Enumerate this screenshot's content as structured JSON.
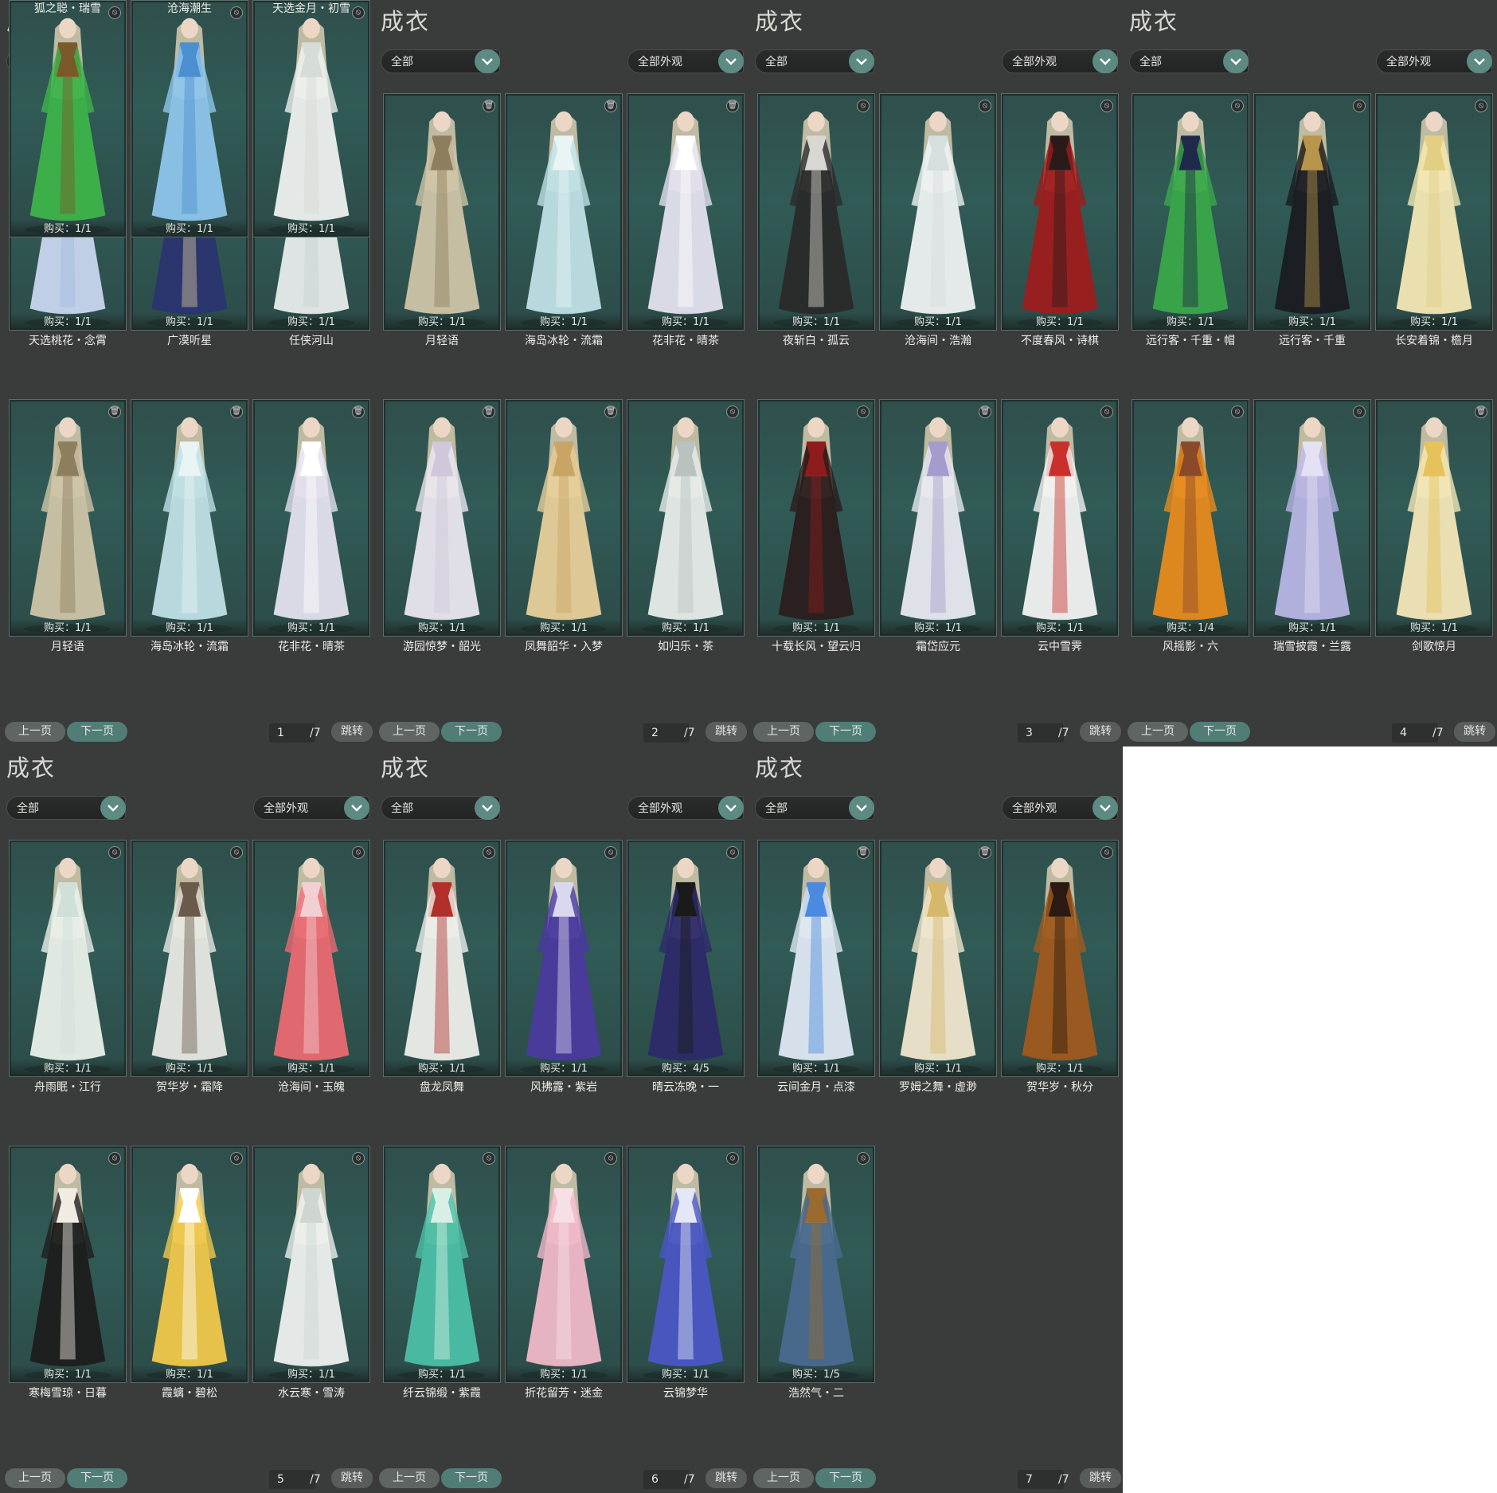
{
  "common": {
    "title": "成衣",
    "filter_left": "全部",
    "filter_right": "全部外观",
    "prev": "上一页",
    "next": "下一页",
    "jump": "跳转",
    "total": "/7"
  },
  "panels": [
    {
      "page": "1",
      "items": [
        {
          "name": "天选桃花・念霄",
          "buy": "购买：1/1",
          "icon": "trash-icon",
          "outfit": "#c9d6ee",
          "accent": "#9fb7e0"
        },
        {
          "name": "广漠听星",
          "buy": "购买：1/1",
          "icon": "trash-icon",
          "outfit": "#2b3470",
          "accent": "#d8c89a"
        },
        {
          "name": "任侠河山",
          "buy": "购买：1/1",
          "icon": "trash-icon",
          "outfit": "#e8ecec",
          "accent": "#c8d0d0"
        },
        {
          "name": "月轻语",
          "buy": "购买：1/1",
          "icon": "trash-icon",
          "outfit": "#cfc4a8",
          "accent": "#8d7f5d"
        },
        {
          "name": "海岛冰轮・流霜",
          "buy": "购买：1/1",
          "icon": "trash-icon",
          "outfit": "#bfe0e6",
          "accent": "#e9f4f4"
        },
        {
          "name": "花非花・晴茶",
          "buy": "购买：1/1",
          "icon": "trash-icon",
          "outfit": "#e4e0ee",
          "accent": "#ffffff"
        },
        {
          "name": "狐之聪・瑞雪",
          "buy": "购买：1/1",
          "icon": "slash-icon",
          "outfit": "#3db44a",
          "accent": "#7a5a2a"
        },
        {
          "name": "沧海潮生",
          "buy": "购买：1/1",
          "icon": "slash-icon",
          "outfit": "#8ec5ea",
          "accent": "#4b8fd0"
        },
        {
          "name": "天选金月・初雪",
          "buy": "购买：1/1",
          "icon": "slash-icon",
          "outfit": "#eef0ee",
          "accent": "#d6dcd8"
        }
      ]
    },
    {
      "page": "2",
      "items": [
        {
          "name": "月轻语",
          "buy": "购买：1/1",
          "icon": "trash-icon",
          "outfit": "#cfc4a8",
          "accent": "#8d7f5d"
        },
        {
          "name": "海岛冰轮・流霜",
          "buy": "购买：1/1",
          "icon": "trash-icon",
          "outfit": "#bfe0e6",
          "accent": "#e9f4f4"
        },
        {
          "name": "花非花・晴茶",
          "buy": "购买：1/1",
          "icon": "trash-icon",
          "outfit": "#e4e0ee",
          "accent": "#ffffff"
        },
        {
          "name": "游园惊梦・韶光",
          "buy": "购买：1/1",
          "icon": "trash-icon",
          "outfit": "#eae6ee",
          "accent": "#cfc8da"
        },
        {
          "name": "凤舞韶华・入梦",
          "buy": "购买：1/1",
          "icon": "trash-icon",
          "outfit": "#e8cf9a",
          "accent": "#c9a565"
        },
        {
          "name": "如归乐・茶",
          "buy": "购买：1/1",
          "icon": "slash-icon",
          "outfit": "#e8ecea",
          "accent": "#b9c2bf"
        }
      ]
    },
    {
      "page": "3",
      "items": [
        {
          "name": "夜斩白・孤云",
          "buy": "购买：1/1",
          "icon": "slash-icon",
          "outfit": "#2a2a2a",
          "accent": "#d8d8d2"
        },
        {
          "name": "沧海间・浩瀚",
          "buy": "购买：1/1",
          "icon": "slash-icon",
          "outfit": "#eef2f2",
          "accent": "#d6dede"
        },
        {
          "name": "不度春风・诗棋",
          "buy": "购买：1/1",
          "icon": "slash-icon",
          "outfit": "#9e1c1c",
          "accent": "#2a1a1a"
        },
        {
          "name": "十载长风・望云归",
          "buy": "购买：1/1",
          "icon": "slash-icon",
          "outfit": "#2b1d1d",
          "accent": "#8e1c1c"
        },
        {
          "name": "霜岱应元",
          "buy": "购买：1/1",
          "icon": "trash-icon",
          "outfit": "#e8eaf0",
          "accent": "#a59ccd"
        },
        {
          "name": "云中雪霁",
          "buy": "购买：1/1",
          "icon": "slash-icon",
          "outfit": "#f2f2f2",
          "accent": "#c9302c"
        }
      ]
    },
    {
      "page": "4",
      "items": [
        {
          "name": "远行客・千重・帽",
          "buy": "购买：1/1",
          "icon": "slash-icon",
          "outfit": "#3aa84a",
          "accent": "#1f2a4a"
        },
        {
          "name": "远行客・千重",
          "buy": "购买：1/1",
          "icon": "slash-icon",
          "outfit": "#1a1c22",
          "accent": "#b7954a"
        },
        {
          "name": "长安着锦・檐月",
          "buy": "购买：1/1",
          "icon": "slash-icon",
          "outfit": "#f3e7b4",
          "accent": "#e2cf84"
        },
        {
          "name": "风摇影・六",
          "buy": "购买：1/4",
          "icon": "slash-icon",
          "outfit": "#e78a1c",
          "accent": "#8a4a2a"
        },
        {
          "name": "瑞雪披霞・兰露",
          "buy": "购买：1/1",
          "icon": "slash-icon",
          "outfit": "#b8b4e4",
          "accent": "#e4e2f2"
        },
        {
          "name": "剑歌惊月",
          "buy": "购买：1/1",
          "icon": "trash-icon",
          "outfit": "#f3e7b8",
          "accent": "#e6c25a"
        }
      ]
    },
    {
      "page": "5",
      "items": [
        {
          "name": "舟雨眠・江行",
          "buy": "购买：1/1",
          "icon": "slash-icon",
          "outfit": "#eaf0ea",
          "accent": "#cfe0d8"
        },
        {
          "name": "贺华岁・霜降",
          "buy": "购买：1/1",
          "icon": "slash-icon",
          "outfit": "#e8e8e4",
          "accent": "#6a5a4a"
        },
        {
          "name": "沧海间・玉魄",
          "buy": "购买：1/1",
          "icon": "slash-icon",
          "outfit": "#ea6a72",
          "accent": "#f2cfd2"
        },
        {
          "name": "寒梅雪琼・日暮",
          "buy": "购买：1/1",
          "icon": "slash-icon",
          "outfit": "#1e1e1e",
          "accent": "#f0ece4"
        },
        {
          "name": "霞螭・碧松",
          "buy": "购买：1/1",
          "icon": "slash-icon",
          "outfit": "#f0c84a",
          "accent": "#ffffff"
        },
        {
          "name": "水云寒・雪涛",
          "buy": "购买：1/1",
          "icon": "slash-icon",
          "outfit": "#eef0ee",
          "accent": "#cfd6d2"
        }
      ]
    },
    {
      "page": "6",
      "items": [
        {
          "name": "盘龙凤舞",
          "buy": "购买：1/1",
          "icon": "slash-icon",
          "outfit": "#eeeeea",
          "accent": "#b2302c"
        },
        {
          "name": "风拂露・紫岩",
          "buy": "购买：1/1",
          "icon": "slash-icon",
          "outfit": "#4a3a9e",
          "accent": "#d9d8ee"
        },
        {
          "name": "晴云冻晚・一",
          "buy": "购买：4/5",
          "icon": "slash-icon",
          "outfit": "#2d2a6a",
          "accent": "#1a1a1a"
        },
        {
          "name": "纤云锦缎・紫霞",
          "buy": "购买：1/1",
          "icon": "slash-icon",
          "outfit": "#4cbfa5",
          "accent": "#d8efe6"
        },
        {
          "name": "折花留芳・迷金",
          "buy": "购买：1/1",
          "icon": "slash-icon",
          "outfit": "#f0b8c8",
          "accent": "#f7dfe6"
        },
        {
          "name": "云锦梦华",
          "buy": "购买：1/1",
          "icon": "slash-icon",
          "outfit": "#4a56c4",
          "accent": "#e4e8f6"
        }
      ]
    },
    {
      "page": "7",
      "items": [
        {
          "name": "云间金月・点漆",
          "buy": "购买：1/1",
          "icon": "trash-icon",
          "outfit": "#dfe8f2",
          "accent": "#4a8ae0"
        },
        {
          "name": "罗姆之舞・虚渺",
          "buy": "购买：1/1",
          "icon": "trash-icon",
          "outfit": "#f0e6cc",
          "accent": "#d6b86a"
        },
        {
          "name": "贺华岁・秋分",
          "buy": "购买：1/1",
          "icon": "slash-icon",
          "outfit": "#a05a1e",
          "accent": "#2a1a12"
        },
        {
          "name": "浩然气・二",
          "buy": "购买：1/5",
          "icon": "slash-icon",
          "outfit": "#4a6a8e",
          "accent": "#9a6a2e"
        }
      ]
    }
  ]
}
